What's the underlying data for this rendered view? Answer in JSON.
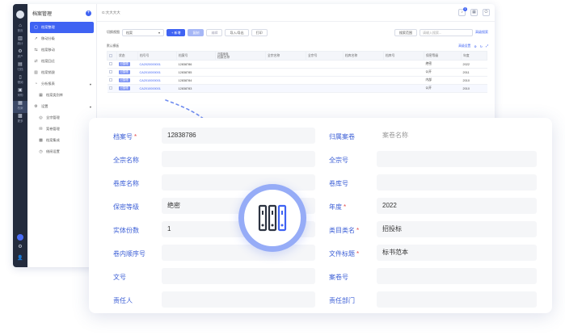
{
  "app": {
    "title": "档案管理",
    "breadcrumb": "G:大大大大",
    "notification_count": "1",
    "rail_items": [
      {
        "icon": "home-icon",
        "label": "首页"
      },
      {
        "icon": "bar-chart-icon",
        "label": "统计"
      },
      {
        "icon": "gear-icon",
        "label": "资产"
      },
      {
        "icon": "folder-icon",
        "label": "归档"
      },
      {
        "icon": "book-icon",
        "label": "借阅"
      },
      {
        "icon": "briefcase-icon",
        "label": "采购"
      },
      {
        "icon": "archive-icon",
        "label": "档案"
      },
      {
        "icon": "grid-icon",
        "label": "更多"
      }
    ],
    "menu": [
      {
        "label": "档案整理",
        "icon": "file-icon",
        "active": true
      },
      {
        "label": "移动分级",
        "icon": "trend-icon"
      },
      {
        "label": "档案移动",
        "icon": "user-move-icon"
      },
      {
        "label": "档案回迁",
        "icon": "swap-icon"
      },
      {
        "label": "档案销毁",
        "icon": "trash-icon"
      },
      {
        "label": "分析报表",
        "icon": "pie-icon",
        "group": true
      },
      {
        "label": "档案类别库",
        "icon": "table-icon",
        "sub": true
      },
      {
        "label": "设置",
        "icon": "gear-icon",
        "group": true
      },
      {
        "label": "全宗管理",
        "icon": "globe-icon",
        "sub": true
      },
      {
        "label": "案卷管理",
        "icon": "mail-icon",
        "sub": true
      },
      {
        "label": "档案集成",
        "icon": "apps-icon",
        "sub": true
      },
      {
        "label": "借阅设置",
        "icon": "clock-icon",
        "sub": true
      }
    ],
    "toolbar": {
      "view_label": "切换视图",
      "view_value": "档案",
      "new_label": "+ 新增",
      "copy_label": "复制",
      "edit_label": "编辑",
      "import_label": "导入/导出",
      "print_label": "打印",
      "search_scope": "搜索范围",
      "search_placeholder": "请输入搜索...",
      "advanced_label": "高级搜索"
    },
    "subbar": {
      "left": "默认模板",
      "right": "高级设置"
    },
    "table": {
      "columns": [
        "状态",
        "档号号",
        "档案号",
        "档案名称",
        "全宗名称",
        "全宗号",
        "档库名称",
        "档库号",
        "保密等级",
        "年度"
      ],
      "group_header": "归属案卷",
      "rows": [
        {
          "status": "已整理",
          "code": "CA2020000001",
          "number": "12838786",
          "secret": "绝密",
          "year": "2022"
        },
        {
          "status": "已整理",
          "code": "CA2010000001",
          "number": "12838785",
          "secret": "公开",
          "year": "2011"
        },
        {
          "status": "已整理",
          "code": "CA2010000001",
          "number": "12838784",
          "secret": "内部",
          "year": "2010"
        },
        {
          "status": "已整理",
          "code": "CA2010000001",
          "number": "12838783",
          "secret": "公开",
          "year": "2010"
        }
      ]
    }
  },
  "form": {
    "fields": [
      {
        "label": "档案号",
        "required": true,
        "value": "12838786"
      },
      {
        "label": "归属案卷",
        "required": false,
        "placeholder": "案卷名称"
      },
      {
        "label": "全宗名称",
        "required": false,
        "value": ""
      },
      {
        "label": "全宗号",
        "required": false,
        "value": ""
      },
      {
        "label": "卷库名称",
        "required": false,
        "value": ""
      },
      {
        "label": "卷库号",
        "required": false,
        "value": ""
      },
      {
        "label": "保密等级",
        "required": false,
        "value": "绝密"
      },
      {
        "label": "年度",
        "required": true,
        "value": "2022"
      },
      {
        "label": "实体份数",
        "required": false,
        "value": "1"
      },
      {
        "label": "类目类名",
        "required": true,
        "value": "招投标"
      },
      {
        "label": "卷内顺序号",
        "required": false,
        "value": ""
      },
      {
        "label": "文件标题",
        "required": true,
        "value": "标书范本"
      },
      {
        "label": "文号",
        "required": false,
        "value": ""
      },
      {
        "label": "案卷号",
        "required": false,
        "value": ""
      },
      {
        "label": "责任人",
        "required": false,
        "value": ""
      },
      {
        "label": "责任部门",
        "required": false,
        "value": ""
      }
    ]
  },
  "colors": {
    "accent": "#3f63f3",
    "label": "#3c5fd6",
    "required": "#e34d4d",
    "ring": "#96acf7",
    "rail": "#232b3d"
  },
  "hub_icon": "archive-binders-icon"
}
